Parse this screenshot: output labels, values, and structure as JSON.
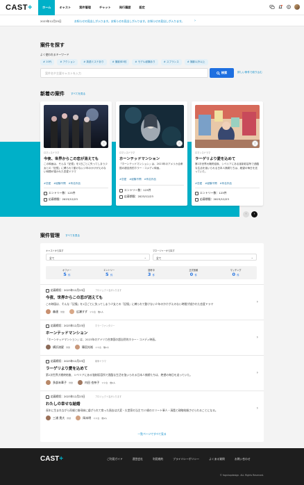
{
  "header": {
    "logo": "CAST",
    "logo_plus": "+",
    "nav": [
      "ホーム",
      "キャスト",
      "案件管理",
      "チャット",
      "発行履歴",
      "設定"
    ]
  },
  "notice": {
    "date": "2023年12月25日",
    "message": "お知らせの見出しが入ります。お知らせの見出しが入ります。お知らせの見出しが入ります。",
    "arrow": "›"
  },
  "search": {
    "title": "案件を探す",
    "keyword_label": "よく使われるキーワード",
    "keywords": [
      "# 10代",
      "# アクション",
      "# 英語ミステあり",
      "# 撮影体5校",
      "# モデル経験あり",
      "# スプランス",
      "# 撮影以外以上"
    ],
    "placeholder": "案件名や主要キャストを入力",
    "button": "検索",
    "advanced": "詳しい条件で絞り込む"
  },
  "new_jobs": {
    "title": "新着の案件",
    "link": "すべてを見る",
    "cards": [
      {
        "category": "ロマンスドラマ",
        "title": "今夜、世界からこの恋が消えても",
        "desc": "この映画は、そんな「記憶」を1日ごとに失ってしまう少女との「記憶」に縛られて動けない少年のかけがえのない時間が描かれた恋愛ドラマ",
        "tags": [
          "#恋愛",
          "#経験不問",
          "#有名作品"
        ],
        "entries": "エントリー数：123件",
        "deadline": "応募期限：2023/12/23"
      },
      {
        "category": "ロマンスドラマ",
        "title": "ホーンテッドマンション",
        "desc": "「ホーンテッドマンション」は、2023年のアメリカ合衆国の超自然的ホラー・コメディ映画。",
        "tags": [
          "#恋愛",
          "#経験不問",
          "#有名作品"
        ],
        "entries": "エントリー数：123件",
        "deadline": "応募期限：2023/12/23"
      },
      {
        "category": "ロマンスドラマ",
        "title": "ラーゲリより愛を込めて",
        "desc": "第2次世界大戦終結後、シベリアにある強制収容所で過酷な生活を強いられる日本人捕虜たちは、絶望の毎日を送っていた。",
        "tags": [
          "#恋愛",
          "#経験不問",
          "#有名作品"
        ],
        "entries": "エントリー数：123件",
        "deadline": "応募期限：2023/12/23"
      }
    ],
    "prev": "‹",
    "next": "›"
  },
  "management": {
    "title": "案件管理",
    "link": "すべてを見る",
    "filter_cast_label": "キャストから探す",
    "filter_cast_value": "全て",
    "filter_manager_label": "マネージャーから探す",
    "filter_manager_value": "全て",
    "stats": [
      {
        "label": "オファー",
        "value": "5",
        "unit": "件"
      },
      {
        "label": "エントリー",
        "value": "5",
        "unit": "件"
      },
      {
        "label": "選考中",
        "value": "3",
        "unit": "件"
      },
      {
        "label": "正式依頼",
        "value": "0",
        "unit": "件"
      },
      {
        "label": "マッチング",
        "value": "0",
        "unit": "件"
      }
    ],
    "rows": [
      {
        "date": "応募締切：2023年12月23日",
        "category": "プロジェクト名が入ります",
        "title": "今夜、世界からこの恋が消えても",
        "desc": "この映画は、そんな「記憶」を1日ごとに失ってしまう少女との「記憶」に縛られて動けない少年のかけがえのない時間が描かれた恋愛ドラマ",
        "p1_name": "森達",
        "p1_role": "俳優",
        "p2_name": "広瀬すず",
        "p2_role": "マネ会",
        "count": "他1人"
      },
      {
        "date": "応募締切：2023年12月23日",
        "category": "ホラーファンタジー",
        "title": "ホーンテッドマンション",
        "desc": "「ホーンテッドマンション」は、2023年のアメリカ合衆国の超自然的ホラー・コメディ映画。",
        "p1_name": "横浜流星",
        "p1_role": "俳優",
        "p2_name": "篠田光裕",
        "p2_role": "マネ会",
        "count": "他1人"
      },
      {
        "date": "応募締切：2023年12月23日",
        "category": "戦争ドラマ",
        "title": "ラーゲリより愛を込めて",
        "desc": "第2次世界大戦終結後、シベリアにある強制収容所で過酷な生活を強いられる日本人捕虜たちは、絶望の毎日を送っていた。",
        "p1_name": "多部未華子",
        "p1_role": "俳優",
        "p2_name": "内田 也奈子",
        "p2_role": "マネ会",
        "count": "他1人"
      },
      {
        "date": "応募締切：2023年12月23日",
        "category": "プロジェクト名が入ります",
        "title": "わたしの幸せな結婚",
        "desc": "長年に生まれながら両親と継母妹に虐げられて育った過去は大変・久堂家の当主で27歳のエリート軍人・清霞と政略結婚させられることになる。",
        "p1_name": "三浦 貴大",
        "p1_role": "俳優",
        "p2_name": "岡本明",
        "p2_role": "マネ会",
        "count": "他1人"
      }
    ],
    "more": "一覧ページですべて見る"
  },
  "footer": {
    "logo": "CAST",
    "logo_plus": "+",
    "links": [
      "ご利用ガイド",
      "運営会社",
      "利用規約",
      "プライバシーポリシー",
      "よくある質問",
      "お問い合わせ"
    ],
    "copyright": "© fogshopdesign. ALL Rights Reserved."
  },
  "colors": {
    "accent": "#00b0c8",
    "primary": "#1e6fe0",
    "link": "#0088c8",
    "footer": "#1e1e1e"
  }
}
